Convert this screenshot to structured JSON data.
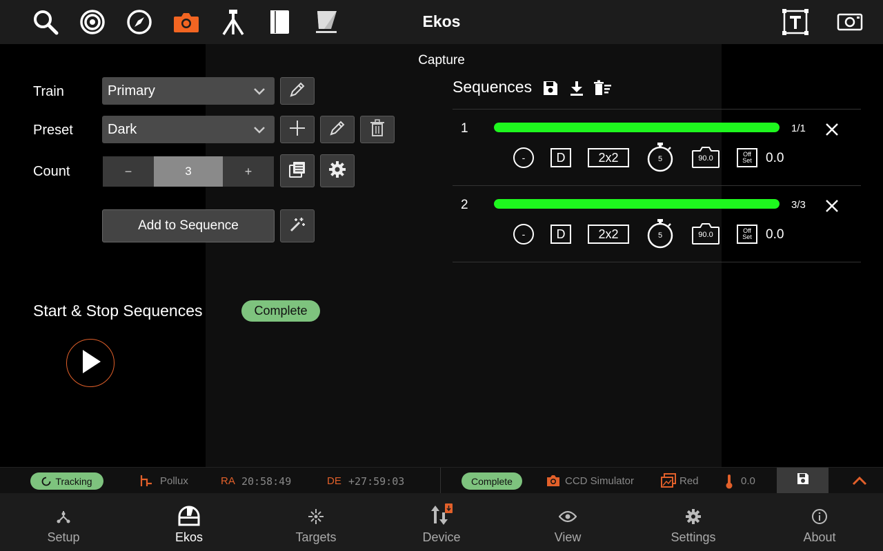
{
  "app": {
    "title": "Ekos"
  },
  "colors": {
    "accent": "#e2602a",
    "progress": "#1ef71e",
    "complete": "#7ec37e"
  },
  "toolbar": {
    "icons": [
      "search-icon",
      "target-icon",
      "compass-icon",
      "camera-icon",
      "tripod-icon",
      "notebook-icon",
      "flat-panel-icon",
      "text-frame-icon",
      "frame-icon"
    ],
    "active": "camera-icon"
  },
  "capture": {
    "title": "Capture",
    "train": {
      "label": "Train",
      "value": "Primary"
    },
    "preset": {
      "label": "Preset",
      "value": "Dark"
    },
    "count": {
      "label": "Count",
      "value": "3",
      "minus": "−",
      "plus": "+"
    },
    "add_button": "Add to Sequence",
    "start_stop_label": "Start & Stop Sequences",
    "status": "Complete"
  },
  "sequences": {
    "title": "Sequences",
    "items": [
      {
        "num": "1",
        "progress_text": "1/1",
        "progress_fraction": 1.0,
        "filter": "-",
        "type": "D",
        "bin": "2x2",
        "exposure": "5",
        "temp": "90.0",
        "offset_label_top": "Off",
        "offset_label_bottom": "Set",
        "gain": "0.0"
      },
      {
        "num": "2",
        "progress_text": "3/3",
        "progress_fraction": 1.0,
        "filter": "-",
        "type": "D",
        "bin": "2x2",
        "exposure": "5",
        "temp": "90.0",
        "offset_label_top": "Off",
        "offset_label_bottom": "Set",
        "gain": "0.0"
      }
    ]
  },
  "statusbar": {
    "tracking": "Tracking",
    "target": "Pollux",
    "ra_label": "RA",
    "ra_value": "20:58:49",
    "de_label": "DE",
    "de_value": "+27:59:03",
    "capture_status": "Complete",
    "camera": "CCD Simulator",
    "filter": "Red",
    "temperature": "0.0"
  },
  "nav": {
    "items": [
      {
        "label": "Setup",
        "icon": "setup-icon"
      },
      {
        "label": "Ekos",
        "icon": "observatory-icon"
      },
      {
        "label": "Targets",
        "icon": "targets-icon"
      },
      {
        "label": "Device",
        "icon": "device-icon"
      },
      {
        "label": "View",
        "icon": "eye-icon"
      },
      {
        "label": "Settings",
        "icon": "gear-icon"
      },
      {
        "label": "About",
        "icon": "info-icon"
      }
    ],
    "active": "Ekos"
  }
}
